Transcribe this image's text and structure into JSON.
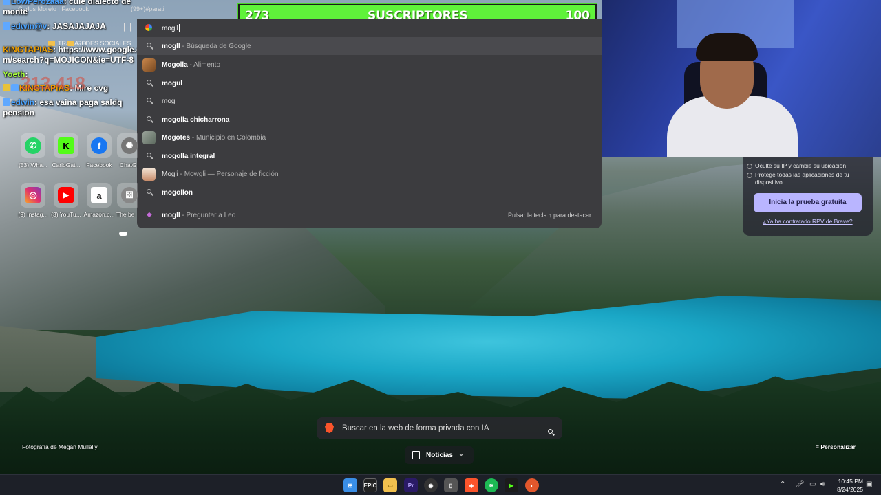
{
  "chat": {
    "messages": [
      {
        "user": "LowPerozaaa",
        "text": "culé dialecto de monte",
        "user_color": "#4aa3ff"
      },
      {
        "user": "edwin@v",
        "text": "JASAJAJAJA",
        "user_color": "#4aa3ff"
      },
      {
        "user": "KINGTAPIAS",
        "text": "https://www.google.com/search?q=MOJICON&ie=UTF-8",
        "user_color": "#f0a000"
      },
      {
        "user": "Yoeth",
        "text": "",
        "user_color": "#a8ff3c"
      },
      {
        "user": "KINGTAPIAS",
        "text": "Mire cvg",
        "user_color": "#f0a000"
      },
      {
        "user": "edwin",
        "text": "esa vaina paga saldq pension",
        "user_color": "#4aa3ff"
      }
    ],
    "ghost_number": "313.418"
  },
  "tabstrip": {
    "tab1": "Carlos Morelo | Facebook",
    "tab2": "(99+)#parati"
  },
  "bookmarks": {
    "items": [
      "TRABAJO",
      "REDES SOCIALES"
    ]
  },
  "subbar": {
    "count": "273",
    "label": "SUSCRIPTORES",
    "goal": "100",
    "color": "#5ff23a"
  },
  "omnibox": {
    "query": "mogll",
    "suggestions": [
      {
        "bold": "mogll",
        "rest": " - Búsqueda de Google",
        "icon": "search-icon",
        "selected": true
      },
      {
        "bold": "Mogolla",
        "rest": " - Alimento",
        "icon": "food-thumbnail"
      },
      {
        "bold": "mogul",
        "rest": "",
        "icon": "search-icon"
      },
      {
        "bold": "mog",
        "rest": "",
        "icon": "search-icon"
      },
      {
        "bold": "mogolla chicharrona",
        "rest": "",
        "icon": "search-icon"
      },
      {
        "bold": "Mogotes",
        "rest": " - Municipio en Colombia",
        "icon": "place-thumbnail"
      },
      {
        "bold": "mogolla integral",
        "rest": "",
        "icon": "search-icon"
      },
      {
        "bold": "Mogli",
        "rest": " - Mowgli — Personaje de ficción",
        "icon": "character-thumbnail"
      },
      {
        "bold": "mogollon",
        "rest": "",
        "icon": "search-icon"
      },
      {
        "bold": "mogll",
        "rest": " - Preguntar a Leo",
        "icon": "leo-icon"
      }
    ],
    "hint": "Pulsar la tecla ↑ para destacar"
  },
  "shortcuts": [
    {
      "caption": "(53) Wha...",
      "icon": "whatsapp-icon",
      "color": "#25d366",
      "glyph": "✆"
    },
    {
      "caption": "CarloGat...",
      "icon": "kick-icon",
      "color": "#53fc18",
      "glyph": "K"
    },
    {
      "caption": "Facebook",
      "icon": "facebook-icon",
      "color": "#1877f2",
      "glyph": "f"
    },
    {
      "caption": "ChatG",
      "icon": "chatgpt-icon",
      "color": "#777777",
      "glyph": "✺"
    },
    {
      "caption": "(9) Instag...",
      "icon": "instagram-icon",
      "color": "#e1306c",
      "glyph": "◎"
    },
    {
      "caption": "(3) YouTu...",
      "icon": "youtube-icon",
      "color": "#ff0000",
      "glyph": "▶"
    },
    {
      "caption": "Amazon.c...",
      "icon": "amazon-icon",
      "color": "#222222",
      "glyph": "a"
    },
    {
      "caption": "The be",
      "icon": "dice-icon",
      "color": "#888888",
      "glyph": "⚄"
    }
  ],
  "vpn": {
    "items": [
      "Oculte su IP y cambie su ubicación",
      "Protege todas las aplicaciones de tu dispositivo"
    ],
    "cta": "Inicia la prueba gratuita",
    "link": "¿Ya ha contratado RPV de Brave?"
  },
  "search": {
    "placeholder": "Buscar en la web de forma privada con IA"
  },
  "news": {
    "label": "Noticias"
  },
  "photo_credit": "Fotografía de Megan Mullally",
  "customize": "Personalizar",
  "taskbar": {
    "time": "10:45 PM",
    "date": "8/24/2025"
  }
}
